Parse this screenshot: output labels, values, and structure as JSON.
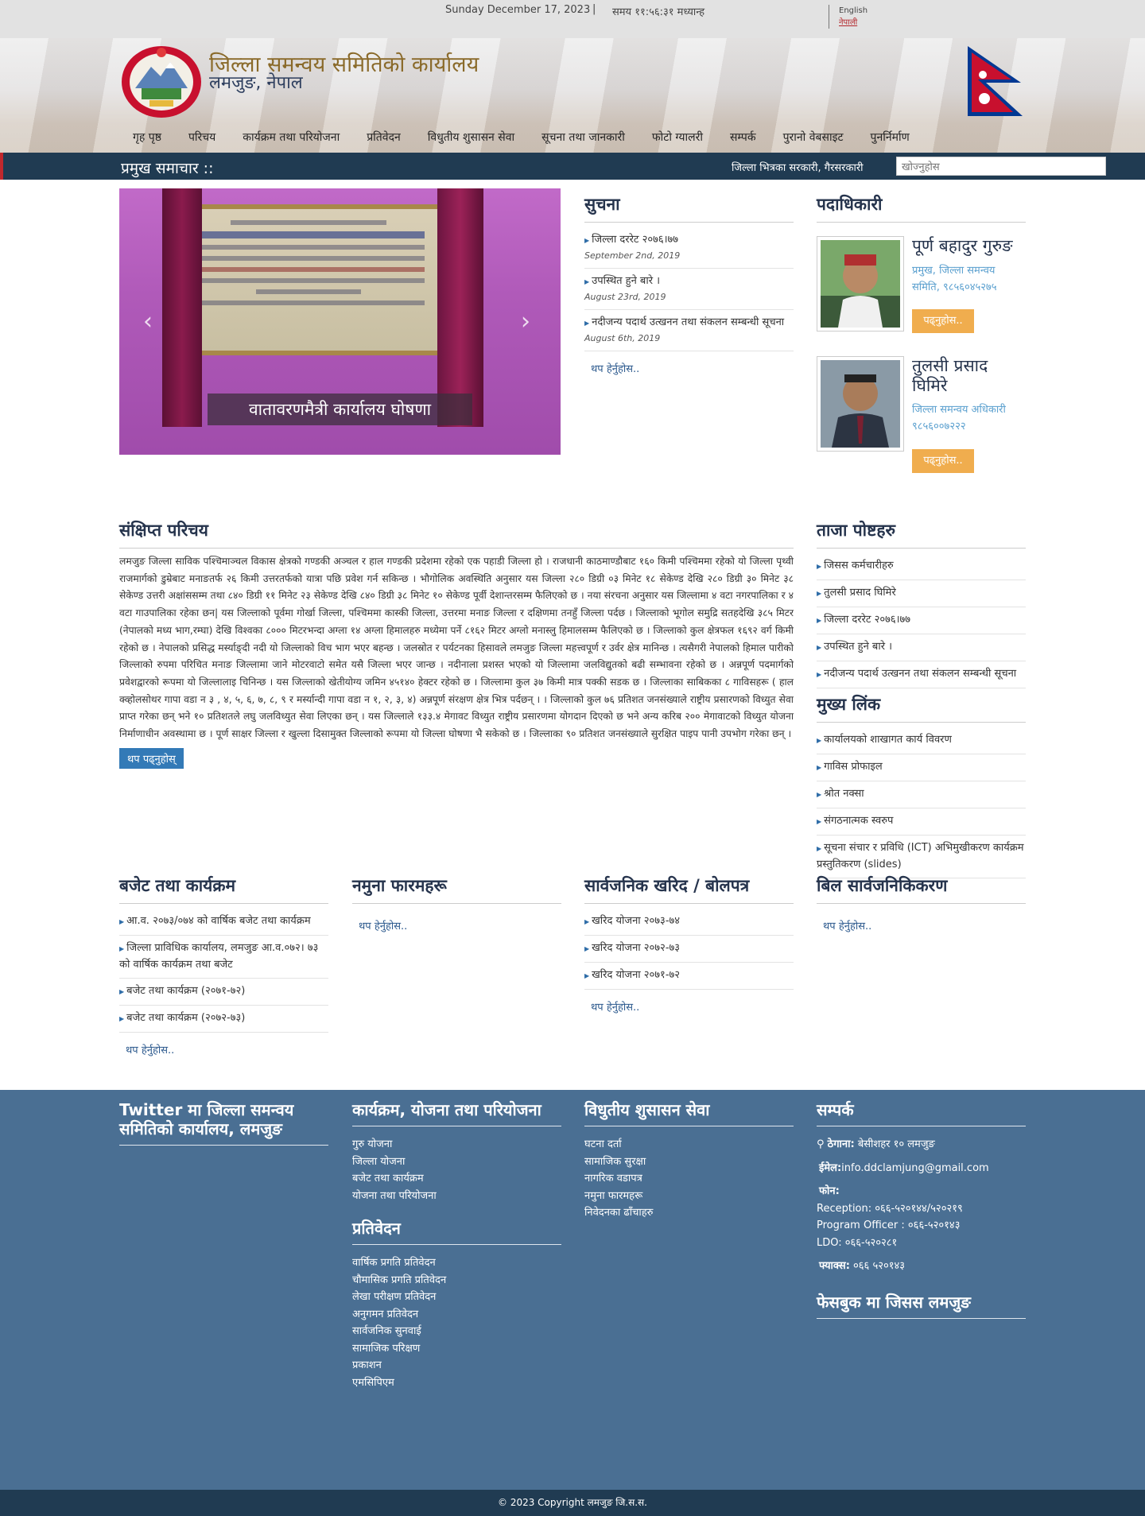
{
  "topbar": {
    "date": "Sunday December 17, 2023",
    "time_label": "समय ११:५६:३१ मध्यान्ह",
    "lang_en": "English",
    "lang_np": "नेपाली"
  },
  "header": {
    "title": "जिल्ला समन्वय समितिको कार्यालय",
    "subtitle": "लमजुङ, नेपाल"
  },
  "nav": [
    "गृह पृष्ठ",
    "परिचय",
    "कार्यक्रम तथा परियोजना",
    "प्रतिवेदन",
    "विधुतीय शुसासन सेवा",
    "सूचना तथा जानकारी",
    "फोटो ग्यालरी",
    "सम्पर्क",
    "पुरानो वेबसाइट",
    "पुनर्निर्माण"
  ],
  "ticker": {
    "label": "प्रमुख समाचार ::",
    "message": "जिल्ला भित्रका सरकारी, गैरसरकारी",
    "search_placeholder": "खोज्नुहोस"
  },
  "slider": {
    "caption": "वातावरणमैत्री कार्यालय घोषणा",
    "prev": "‹",
    "next": "›"
  },
  "notice": {
    "title": "सुचना",
    "items": [
      {
        "text": "जिल्ला दररेट २०७६।७७",
        "date": "September 2nd, 2019"
      },
      {
        "text": "उपस्थित हुने बारे ।",
        "date": "August 23rd, 2019"
      },
      {
        "text": "नदीजन्य पदार्थ उत्खनन तथा संकलन सम्बन्धी सूचना",
        "date": "August 6th, 2019"
      }
    ],
    "more": "थप हेर्नुहोस.."
  },
  "officials": {
    "title": "पदाधिकारी",
    "people": [
      {
        "name": "पूर्ण बहादुर गुरुङ",
        "desc": "प्रमुख, जिल्ला समन्वय समिति, ९८५६०४५२७५",
        "btn": "पढ्नुहोस.."
      },
      {
        "name": "तुलसी प्रसाद घिमिरे",
        "desc": "जिल्ला समन्वय अधिकारी ९८५६००७२२२",
        "btn": "पढ्नुहोस.."
      }
    ]
  },
  "intro": {
    "title": "संक्षिप्त परिचय",
    "text": "लमजुङ जिल्ला साविक पश्चिमाञ्चल विकास क्षेत्रको गण्डकी अञ्चल र हाल गण्डकी प्रदेशमा  रहेको एक पहाडी जिल्ला हो । राजधानी काठमाण्डौबाट १६० किमी पश्चिममा रहेको यो जिल्ला पृथ्वी राजमार्गको डुम्रेबाट मनाङतर्फ २६ किमी उत्तरतर्फको यात्रा पछि प्रवेश गर्न सकिन्छ । भौगोलिक अवस्थिति अनुसार यस जिल्ला २८० डिग्री ०३ मिनेट १८ सेकेण्ड देखि २८० डिग्री ३० मिनेट ३८ सेकेण्ड उत्तरी अक्षांससम्म तथा ८४० डिग्री ११ मिनेट २३ सेकेण्ड देखि ८४० डिग्री ३८ मिनेट १० सेकेण्ड पूर्वी देशान्तरसम्म फैलिएको छ । नया संरचना अनुसार यस जिल्लामा ४ वटा नगरपालिका र ४ वटा गाउपालिका रहेका छन| यस जिल्लाको पूर्वमा गोर्खा जिल्ला, पश्चिममा कास्की जिल्ला, उत्तरमा मनाङ जिल्ला र दक्षिणमा तनहुँ जिल्ला पर्दछ । जिल्लाको भूगोल समुद्रि सतहदेखि ३८५ मिटर (नेपालको मध्य भाग,रम्घा) देखि विश्वका ८००० मिटरभन्दा अग्ला १४ अग्ला हिमालहरु मध्येमा पर्ने ८१६२ मिटर अग्लो मनास्लु हिमालसम्म फैलिएको छ । जिल्लाको कुल क्षेत्रफल १६९२ वर्ग किमी रहेको छ । नेपालको प्रसिद्ध मर्स्याङ्दी नदी यो जिल्लाको विच भाग भएर बहन्छ । जलस्रोत र पर्यटनका हिसावले लमजुङ जिल्ला महत्त्वपूर्ण र उर्वर क्षेत्र मानिन्छ । त्यसैगरी नेपालको हिमाल पारीको जिल्लाको रुपमा परिचित मनाङ जिल्लामा जाने मोटरवाटो समेत यसै जिल्ला भएर  जान्छ । नदीनाला प्रशस्त भएको यो जिल्लामा जलविद्युतको बढी सम्भावना रहेको छ । अन्नपूर्ण पदमार्गको प्रवेशद्वारको रूपमा यो जिल्लालाइ चिनिन्छ । यस जिल्लाको खेतीयोग्य जमिन ४५१४० हेक्टर रहेको छ । जिल्लामा कुल ३७ किमी मात्र पक्की सडक छ । जिल्लाका साबिकका  ८ गाविसहरू ( हाल क्व्होलसोथर गापा वडा न ३ , ४, ५, ६, ७, ८, ९ र मर्स्यान्दी गापा वडा न १, २, ३, ४)  अन्नपूर्ण संरक्षण क्षेत्र भित्र पर्दछन् । । जिल्लाको कुल ७६ प्रतिशत जनसंख्याले राष्ट्रीय प्रसारणको विध्युत सेवा प्राप्त गरेका छन् भने १० प्रतिशतले लघु जलविध्युत सेवा लिएका छन् । यस जिल्लाले १३३.४ मेगावट विध्युत राष्ट्रीय प्रसारणमा योगदान दिएको छ भने अन्य करिब २०० मेगावाटको विध्युत योजना निर्माणाधीन अवस्थामा छ ।  पूर्ण साक्षर जिल्ला र खुल्ला दिसामुक्त जिल्लाको रूपमा यो जिल्ला घोषणा भै सकेको छ । जिल्लाका ९० प्रतिशत जनसंख्याले सुरक्षित पाइप पानी उपभोग गरेका छन् ।",
    "more": "थप पढ्नुहोस्"
  },
  "latest": {
    "title": "ताजा पोष्टहरु",
    "items": [
      "जिसस कर्मचारीहरु",
      "तुलसी प्रसाद घिमिरे",
      "जिल्ला दररेट २०७६।७७",
      "उपस्थित हुने बारे ।",
      "नदीजन्य पदार्थ उत्खनन तथा संकलन सम्बन्धी सूचना"
    ]
  },
  "links": {
    "title": "मुख्य लिंक",
    "items": [
      "कार्यालयको शाखागत कार्य विवरण",
      "गाविस प्रोफाइल",
      "श्रोत नक्सा",
      "संगठनात्मक स्वरुप",
      "सूचना संचार र प्रविधि (ICT) अभिमुखीकरण कार्यक्रम प्रस्तुतिकरण (slides)"
    ]
  },
  "budget": {
    "title": "बजेट तथा कार्यक्रम",
    "items": [
      "आ.व. २०७३/०७४ को वार्षिक बजेट तथा कार्यक्रम",
      "जिल्ला प्राविधिक कार्यालय, लमजुङ आ.व.०७२। ७३ को वार्षिक कार्यक्रम तथा बजेट",
      "बजेट तथा कार्यक्रम (२०७१-७२)",
      "बजेट तथा कार्यक्रम (२०७२-७३)"
    ],
    "more": "थप हेर्नुहोस.."
  },
  "forms": {
    "title": "नमुना फारमहरू",
    "more": "थप हेर्नुहोस.."
  },
  "procurement": {
    "title": "सार्वजनिक खरिद / बोलपत्र",
    "items": [
      "खरिद योजना २०७३-७४",
      "खरिद योजना २०७२-७३",
      "खरिद योजना २०७१-७२"
    ],
    "more": "थप हेर्नुहोस.."
  },
  "bills": {
    "title": "बिल सार्वजनिकिकरण",
    "more": "थप हेर्नुहोस.."
  },
  "footer": {
    "twitter_title": "Twitter मा जिल्ला समन्वय समितिको कार्यालय, लमजुङ",
    "programs": {
      "title": "कार्यक्रम, योजना तथा परियोजना",
      "items": [
        "गुरु योजना",
        "जिल्ला योजना",
        "बजेट तथा कार्यक्रम",
        "योजना तथा परियोजना"
      ]
    },
    "reports": {
      "title": "प्रतिवेदन",
      "items": [
        "वार्षिक प्रगति प्रतिवेदन",
        "चौमासिक प्रगति प्रतिवेदन",
        "लेखा परीक्षण प्रतिवेदन",
        "अनुगमन प्रतिवेदन",
        "सार्वजनिक सुनवाई",
        "सामाजिक परिक्षण",
        "प्रकाशन",
        "एमसिपिएम"
      ]
    },
    "egov": {
      "title": "विधुतीय शुसासन सेवा",
      "items": [
        "घटना दर्ता",
        "सामाजिक सुरक्षा",
        "नागरिक वडापत्र",
        "नमुना फारमहरू",
        "निवेदनका ढाँचाहरु"
      ]
    },
    "contact": {
      "title": "सम्पर्क",
      "address_label": "ठेगाना:",
      "address": " बेसीशहर १० लमजुङ",
      "email_label": "ईमेल:",
      "email": "info.ddclamjung@gmail.com",
      "phone_label": "फोन:",
      "phone1": "Reception: ०६६-५२०१४४/५२०२१९",
      "phone2": "Program Officer : ०६६-५२०१४३",
      "phone3": "LDO: ०६६-५२०२८१",
      "fax_label": "फ्याक्स:",
      "fax": " ०६६ ५२०१४३"
    },
    "facebook_title": "फेसबुक मा जिसस लमजुङ"
  },
  "copyright": "© 2023 Copyright लमजुङ जि.स.स.",
  "colors": {
    "navy": "#203b52",
    "footer": "#4a6f93",
    "accent": "#f0ad4e",
    "link": "#2d5a8e",
    "flag_red": "#c8102e",
    "flag_blue": "#003893"
  }
}
